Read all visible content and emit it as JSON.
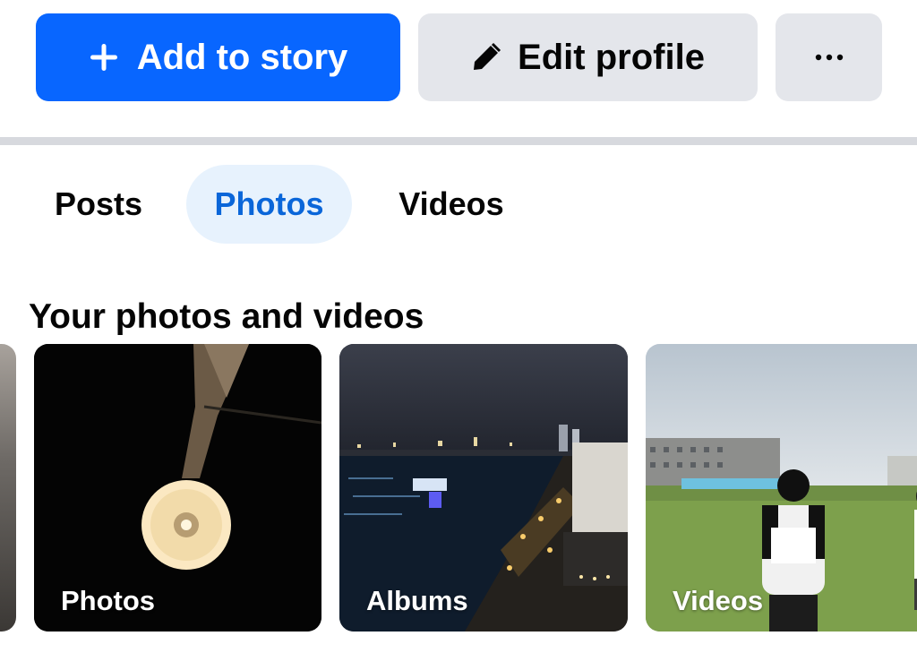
{
  "actions": {
    "add_story_label": "Add to story",
    "add_story_icon": "plus-icon",
    "edit_profile_label": "Edit profile",
    "edit_profile_icon": "pencil-icon",
    "more_label": "···",
    "more_icon": "more-icon",
    "primary_color": "#0866ff",
    "secondary_color": "#e4e6eb"
  },
  "tabs": [
    {
      "label": "Posts",
      "selected": false
    },
    {
      "label": "Photos",
      "selected": true
    },
    {
      "label": "Videos",
      "selected": false
    }
  ],
  "section": {
    "title": "Your photos and videos"
  },
  "cards": [
    {
      "label": "Photos"
    },
    {
      "label": "Albums"
    },
    {
      "label": "Videos"
    }
  ],
  "colors": {
    "selected_tab_bg": "#e7f2fd",
    "selected_tab_text": "#0a66d9"
  }
}
